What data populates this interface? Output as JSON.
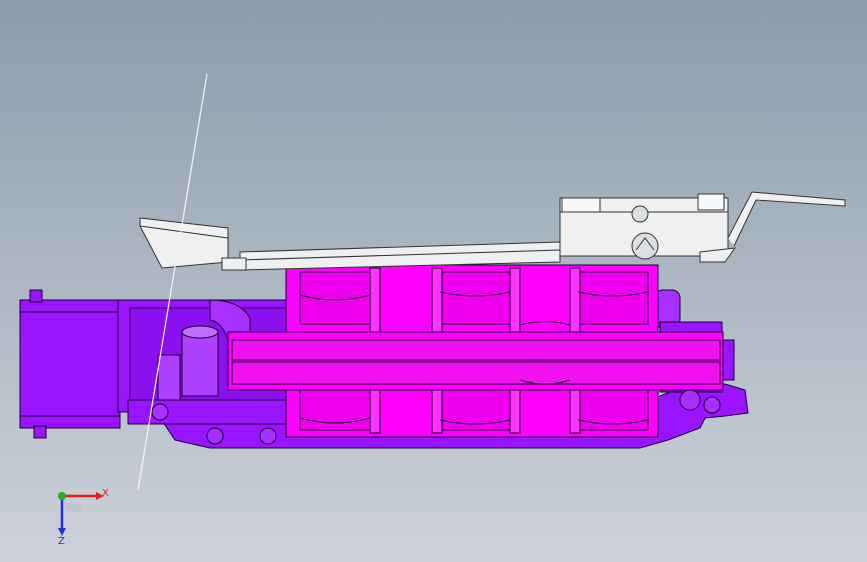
{
  "viewport": {
    "background_top": "#8c9bab",
    "background_bottom": "#cdd2d9"
  },
  "model": {
    "body_color": "#9a14ff",
    "section_color": "#ff00ff",
    "bracket_color": "#eef0f2",
    "edge_color": "#1a0030"
  },
  "triad": {
    "x_label": "X",
    "z_label": "Z",
    "x_color": "#e02020",
    "y_color": "#20b020",
    "z_color": "#2030d0",
    "icon": "coordinate-triad-icon"
  }
}
